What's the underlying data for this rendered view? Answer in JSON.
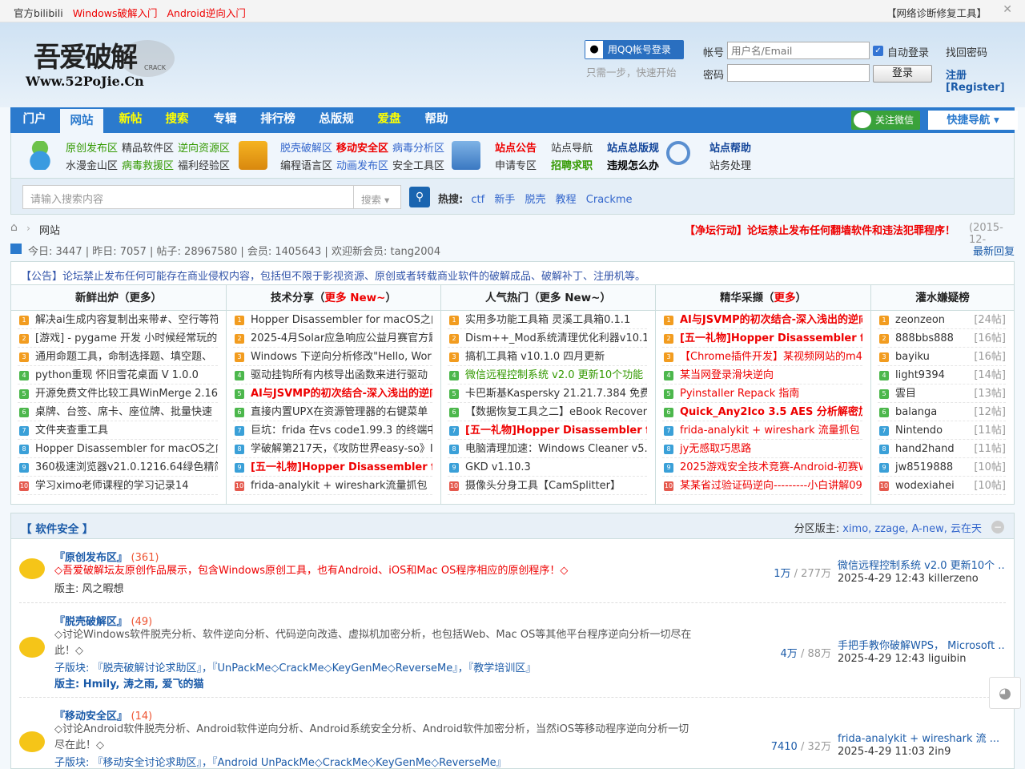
{
  "topbar": {
    "links": [
      "官方bilibili",
      "Windows破解入门",
      "Android逆向入门"
    ],
    "right": "【网络诊断修复工具】",
    "close": "✕"
  },
  "logo": {
    "text": "吾爱破解",
    "url": "Www.52PoJie.Cn",
    "crack": "CRACK"
  },
  "login": {
    "qq_label": "用QQ帐号登录",
    "qq_sub": "只需一步，快速开始",
    "account_label": "帐号",
    "account_placeholder": "用户名/Email",
    "password_label": "密码",
    "auto_login": "自动登录",
    "login_btn": "登录",
    "find_pwd": "找回密码",
    "register": "注册[Register]"
  },
  "nav": {
    "items": [
      "门户",
      "网站",
      "新帖",
      "搜索",
      "专辑",
      "排行榜",
      "总版规",
      "爱盘",
      "帮助"
    ],
    "wechat": "关注微信",
    "quick": "快捷导航 ▾"
  },
  "sub": {
    "g1": [
      "原创发布区",
      "精品软件区",
      "逆向资源区",
      "水漫金山区",
      "病毒救援区",
      "福利经验区"
    ],
    "g2": [
      "脱壳破解区",
      "移动安全区",
      "病毒分析区",
      "编程语言区",
      "动画发布区",
      "安全工具区"
    ],
    "g3": [
      "站点公告",
      "站点导航",
      "站点总版规",
      "申请专区",
      "招聘求职",
      "违规怎么办"
    ],
    "g4": [
      "站点帮助",
      "站务处理"
    ]
  },
  "search": {
    "placeholder": "请输入搜索内容",
    "select": "搜索",
    "hot_label": "热搜:",
    "hot": [
      "ctf",
      "新手",
      "脱壳",
      "教程",
      "Crackme"
    ]
  },
  "breadcrumb": {
    "home": "网站",
    "notice": "【净坛行动】论坛禁止发布任何翻墙软件和违法犯罪程序！",
    "date": "(2015-12-"
  },
  "stats": {
    "today": "今日: 3447",
    "yesterday": "昨日: 7057",
    "posts": "帖子: 28967580",
    "members": "会员: 1405643",
    "welcome": "欢迎新会员: tang2004",
    "latest": "最新回复"
  },
  "notice": "【公告】论坛禁止发布任何可能存在商业侵权内容，包括但不限于影视资源、原创或者转载商业软件的破解成品、破解补丁、注册机等。",
  "columns": [
    {
      "title": "新鲜出炉（更多）",
      "items": [
        "解决ai生成内容复制出来带#、空行等符",
        "[游戏] - pygame 开发 小时候经常玩的 象",
        "通用命题工具，命制选择题、填空题、",
        "python重现 怀旧雪花桌面 V 1.0.0",
        "开源免费文件比较工具WinMerge 2.16.4",
        "桌牌、台签、席卡、座位牌、批量快速",
        "文件夹查重工具",
        "Hopper Disassembler for macOS之内存",
        "360极速浏览器v21.0.1216.64绿色精简",
        "学习ximo老师课程的学习记录14"
      ]
    },
    {
      "title": "技术分享（更多 New~）",
      "items": [
        "Hopper Disassembler for macOS之内存",
        "2025-4月Solar应急响应公益月赛官方题",
        "Windows 下逆向分析修改\"Hello, World!\"",
        "驱动挂钩所有内核导出函数来进行驱动",
        "AI与JSVMP的初次结合-深入浅出的逆向",
        "直接内置UPX在资源管理器的右键菜单",
        "巨坑：frida 在vs code1.99.3 的终端中无",
        "学破解第217天，《攻防世界easy-so》I",
        "[五一礼物]Hopper Disassembler for m",
        "frida-analykit + wireshark流量抓包"
      ]
    },
    {
      "title": "人气热门（更多 New~）",
      "items": [
        "实用多功能工具箱 灵溪工具箱0.1.1",
        "Dism++_Mod系统清理优化利器v10.1.10",
        "搞机工具箱 v10.1.0 四月更新",
        "微信远程控制系统 v2.0 更新10个功能",
        "卡巴斯基Kaspersky 21.21.7.384 免费版",
        "【数据恢复工具之二】eBook Recovery",
        "[五一礼物]Hopper Disassembler for m",
        "电脑清理加速：Windows Cleaner v5.0.5",
        "GKD v1.10.3",
        "摄像头分身工具【CamSplitter】"
      ]
    },
    {
      "title": "精华采撷（更多）",
      "items": [
        "AI与JSVMP的初次结合-深入浅出的逆向",
        "[五一礼物]Hopper Disassembler for m",
        "【Chrome插件开发】某视频网站的m4s",
        "某当网登录滑块逆向",
        "Pyinstaller Repack 指南",
        "Quick_Any2Ico 3.5 AES 分析解密加注",
        "frida-analykit + wireshark 流量抓包",
        "jy无感取巧思路",
        "2025游戏安全技术竞赛-Android-初赛Wri",
        "某某省过验证码逆向---------小白讲解09"
      ]
    },
    {
      "title": "灌水嫌疑榜",
      "items": [
        "zeonzeon",
        "888bbs888",
        "bayiku",
        "light9394",
        "雲目",
        "balanga",
        "Nintendo",
        "hand2hand",
        "jw8519888",
        "wodexiahei"
      ],
      "counts": [
        "[24帖]",
        "[16帖]",
        "[16帖]",
        "[14帖]",
        "[13帖]",
        "[12帖]",
        "[11帖]",
        "[11帖]",
        "[10帖]",
        "[10帖]"
      ]
    }
  ],
  "section": {
    "title": "【 软件安全 】",
    "mods_label": "分区版主:",
    "mods": "ximo, zzage, A-new, 云在天",
    "collapse": "−"
  },
  "forums": [
    {
      "name": "『原创发布区』",
      "count": "(361)",
      "desc": "◇吾爱破解坛友原创作品展示，包含Windows原创工具，也有Android、iOS和Mac OS程序相应的原创程序！◇",
      "line2": "版主: 风之暇想",
      "threads": "1万",
      "posts": " / 277万",
      "last": "微信远程控制系统 v2.0 更新10个 ...",
      "time": "2025-4-29 12:43 killerzeno"
    },
    {
      "name": "『脱壳破解区』",
      "count": "(49)",
      "desc": "◇讨论Windows软件脱壳分析、软件逆向分析、代码逆向改造、虚拟机加密分析，也包括Web、Mac OS等其他平台程序逆向分析一切尽在此！◇",
      "line2": "子版块: 『脱壳破解讨论求助区』，『UnPackMe◇CrackMe◇KeyGenMe◇ReverseMe』，『教学培训区』",
      "line3": "版主: Hmily, 涛之雨, 爱飞的猫",
      "threads": "4万",
      "posts": " / 88万",
      "last": "手把手教你破解WPS， Microsoft ...",
      "time": "2025-4-29 12:43 liguibin"
    },
    {
      "name": "『移动安全区』",
      "count": "(14)",
      "desc": "◇讨论Android软件脱壳分析、Android软件逆向分析、Android系统安全分析、Android软件加密分析，当然iOS等移动程序逆向分析一切尽在此！◇",
      "line2": "子版块: 『移动安全讨论求助区』，『Android UnPackMe◇CrackMe◇KeyGenMe◇ReverseMe』",
      "threads": "7410",
      "posts": " / 32万",
      "last": "frida-analykit + wireshark 流 ...",
      "time": "2025-4-29 11:03 2in9"
    }
  ],
  "float_icon": "wechat-icon"
}
